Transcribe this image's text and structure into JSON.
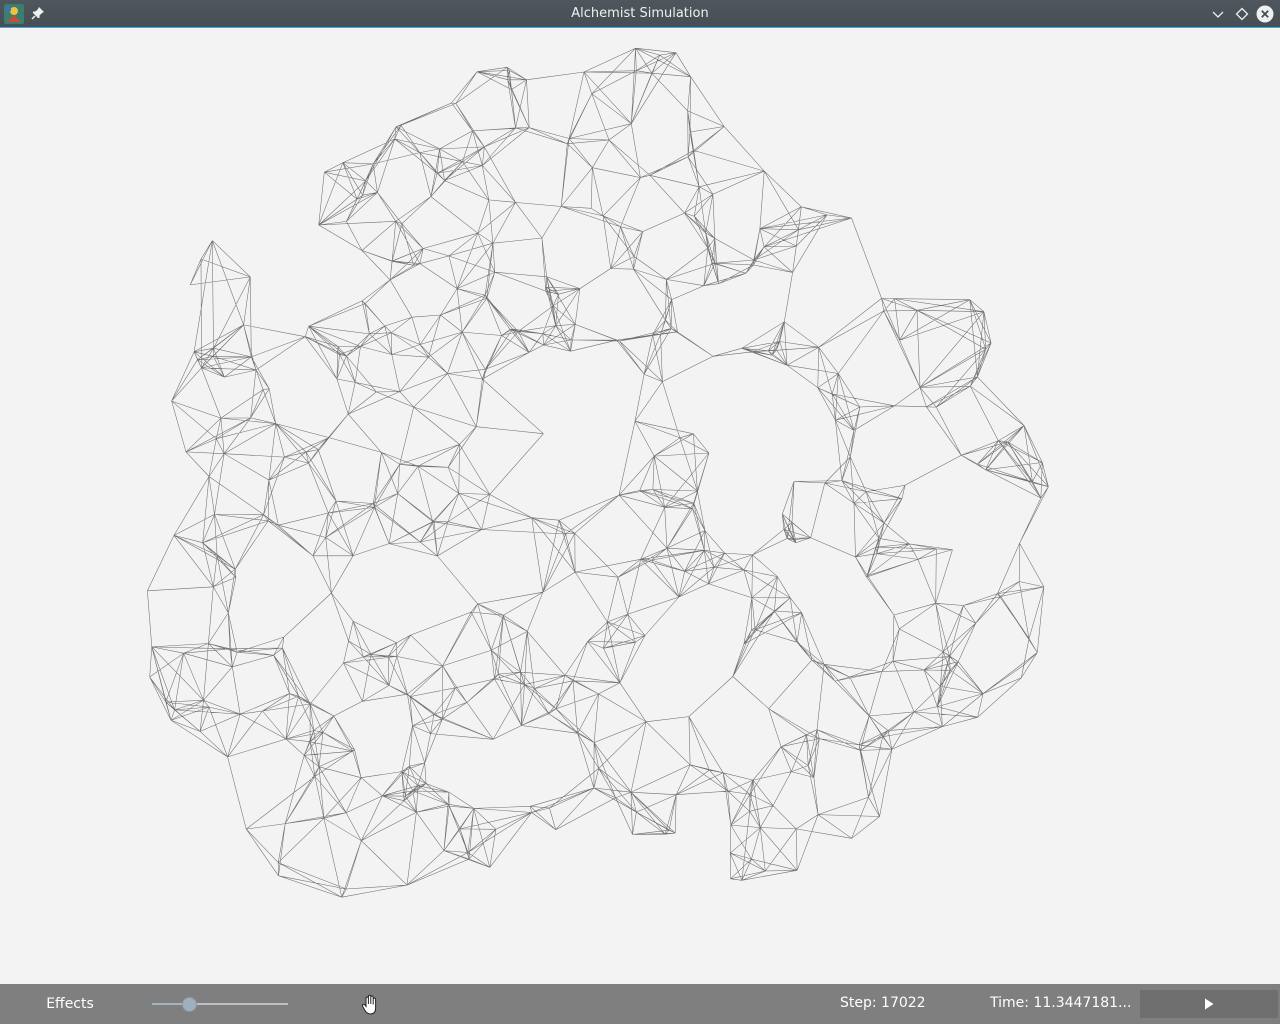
{
  "window": {
    "title": "Alchemist Simulation",
    "icons": [
      "app-icon",
      "pin-icon",
      "minimize-icon",
      "maximize-icon",
      "close-icon"
    ]
  },
  "controls": {
    "effects_label": "Effects",
    "speed_slider_value": 0.27,
    "interaction_mode_icon": "hand-icon",
    "step_label": "Step: 17022",
    "time_label": "Time: 11.3447181...",
    "play_icon": "play-icon"
  },
  "colors": {
    "titlebar_accent": "#3daee9",
    "canvas_background": "#f3f3f3",
    "edge_color": "#000000",
    "bottombar": "#7f7f7f"
  }
}
